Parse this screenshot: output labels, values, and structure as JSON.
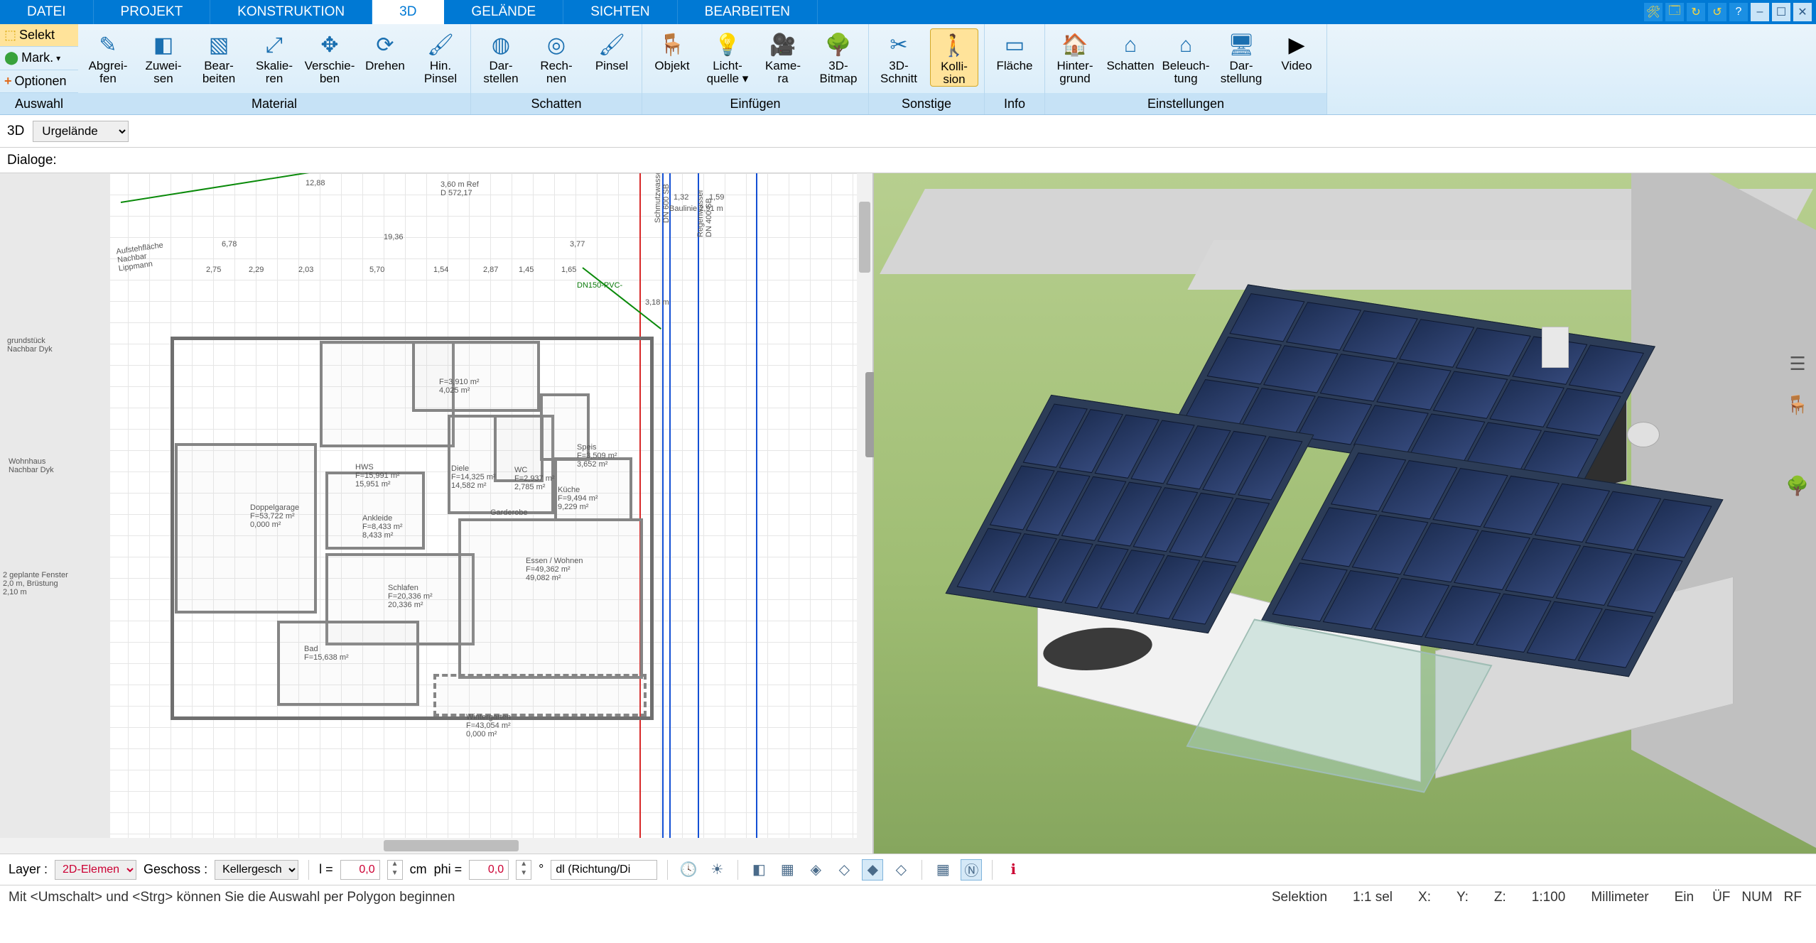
{
  "menu": {
    "tabs": [
      "DATEI",
      "PROJEKT",
      "KONSTRUKTION",
      "3D",
      "GELÄNDE",
      "SICHTEN",
      "BEARBEITEN"
    ],
    "active": "3D",
    "sysbuttons": [
      "tools",
      "save",
      "redo",
      "undo",
      "help",
      "min",
      "max",
      "close"
    ]
  },
  "ribbon_left": {
    "selekt": "Selekt",
    "mark": "Mark.",
    "optionen": "Optionen",
    "group": "Auswahl"
  },
  "ribbon_groups": [
    {
      "label": "Material",
      "tools": [
        {
          "id": "abgreifen",
          "l1": "Abgrei-",
          "l2": "fen",
          "ico": "✎"
        },
        {
          "id": "zuweisen",
          "l1": "Zuwei-",
          "l2": "sen",
          "ico": "◧"
        },
        {
          "id": "bearbeiten",
          "l1": "Bear-",
          "l2": "beiten",
          "ico": "▧"
        },
        {
          "id": "skalieren",
          "l1": "Skalie-",
          "l2": "ren",
          "ico": "⤢"
        },
        {
          "id": "verschieben",
          "l1": "Verschie-",
          "l2": "ben",
          "ico": "✥"
        },
        {
          "id": "drehen",
          "l1": "Drehen",
          "l2": "",
          "ico": "⟳"
        },
        {
          "id": "hinpinsel",
          "l1": "Hin.",
          "l2": "Pinsel",
          "ico": "🖌"
        }
      ]
    },
    {
      "label": "Schatten",
      "tools": [
        {
          "id": "darstellen",
          "l1": "Dar-",
          "l2": "stellen",
          "ico": "◍"
        },
        {
          "id": "rechnen",
          "l1": "Rech-",
          "l2": "nen",
          "ico": "◎"
        },
        {
          "id": "pinsel",
          "l1": "Pinsel",
          "l2": "",
          "ico": "🖌"
        }
      ]
    },
    {
      "label": "Einfügen",
      "tools": [
        {
          "id": "objekt",
          "l1": "Objekt",
          "l2": "",
          "ico": "🪑"
        },
        {
          "id": "lichtquelle",
          "l1": "Licht-",
          "l2": "quelle ▾",
          "ico": "💡"
        },
        {
          "id": "kamera",
          "l1": "Kame-",
          "l2": "ra",
          "ico": "🎥"
        },
        {
          "id": "3dbitmap",
          "l1": "3D-",
          "l2": "Bitmap",
          "ico": "🌳"
        }
      ]
    },
    {
      "label": "Sonstige",
      "tools": [
        {
          "id": "3dschnitt",
          "l1": "3D-",
          "l2": "Schnitt",
          "ico": "✂"
        },
        {
          "id": "kollision",
          "l1": "Kolli-",
          "l2": "sion",
          "ico": "🚶",
          "active": true
        }
      ]
    },
    {
      "label": "Info",
      "tools": [
        {
          "id": "flaeche",
          "l1": "Fläche",
          "l2": "",
          "ico": "▭"
        }
      ]
    },
    {
      "label": "Einstellungen",
      "tools": [
        {
          "id": "hintergrund",
          "l1": "Hinter-",
          "l2": "grund",
          "ico": "🏠"
        },
        {
          "id": "schatten",
          "l1": "Schatten",
          "l2": "",
          "ico": "⌂"
        },
        {
          "id": "beleuchtung",
          "l1": "Beleuch-",
          "l2": "tung",
          "ico": "⌂"
        },
        {
          "id": "darstellung",
          "l1": "Dar-",
          "l2": "stellung",
          "ico": "🖥"
        },
        {
          "id": "video",
          "l1": "Video",
          "l2": "",
          "ico": "▶"
        }
      ]
    }
  ],
  "subbar": {
    "label3d": "3D",
    "terrain_options": [
      "Urgelände"
    ],
    "terrain_value": "Urgelände"
  },
  "dialoge_label": "Dialoge:",
  "plan_labels": {
    "garage": "Doppelgarage\nF=53,722 m²\n0,000 m²",
    "ankleide": "Ankleide\nF=8,433 m²\n8,433 m²",
    "schlafen": "Schlafen\nF=20,336 m²\n20,336 m²",
    "hws": "HWS\nF=15,991 m²\n15,951 m²",
    "bad": "Bad\nF=15,638 m²",
    "diele": "Diele\nF=14,325 m²\n14,582 m²",
    "kueche": "Küche\nF=9,494 m²\n9,229 m²",
    "speis": "Speis\nF=3,509 m²\n3,652 m²",
    "essen": "Essen / Wohnen\nF=49,362 m²\n49,082 m²",
    "winter": "Wintergarten\nF=43,054 m²\n0,000 m²",
    "wc": "WC\nF=2,937 m²\n2,785 m²",
    "garderobe": "Garderobe",
    "top": "F=3,910 m²\n4,025 m²",
    "topdim": "3,60 m Ref\nD 572,17",
    "neighbor1": "Aufstehfläche\nNachbar\nLippmann",
    "neighbor2": "Wohnhaus\nNachbar Dyk",
    "neighbor3": "2 geplante Fenster\n2,0 m, Brüstung\n2,10 m",
    "grund": "grundstück\nNachbar Dyk",
    "schmutz": "Schmutzwasser\nDN 600 SB",
    "regen": "Regenwasser\nDN 400 SB",
    "dn150": "DN150-PVC-",
    "bl": "3,18 m",
    "bauliche": "Baulinie 2,91 m",
    "d1": "1,32",
    "d2": "1,59",
    "dims_top": [
      "6,78",
      "19,36",
      "3,77"
    ],
    "dims_top2": [
      "2,75",
      "2,29",
      "2,03",
      "5,70",
      "1,54",
      "2,87",
      "1,45",
      "1,65"
    ],
    "dims_top3": [
      "12,88"
    ]
  },
  "bottombar": {
    "layer_label": "Layer :",
    "layer_value": "2D-Elemen",
    "geschoss_label": "Geschoss :",
    "geschoss_value": "Kellergesch",
    "l_label": "l =",
    "l_value": "0,0",
    "l_unit": "cm",
    "phi_label": "phi =",
    "phi_value": "0,0",
    "phi_unit": "°",
    "dl_label": "dl (Richtung/Di"
  },
  "status": {
    "hint": "Mit <Umschalt> und <Strg> können Sie die Auswahl per Polygon beginnen",
    "sel": "Selektion",
    "ratio": "1:1 sel",
    "x": "X:",
    "y": "Y:",
    "z": "Z:",
    "scale": "1:100",
    "unit": "Millimeter",
    "ein": "Ein",
    "uf": "ÜF",
    "num": "NUM",
    "rf": "RF"
  },
  "rightstrip": [
    "layers",
    "chair",
    "palette",
    "tree"
  ]
}
